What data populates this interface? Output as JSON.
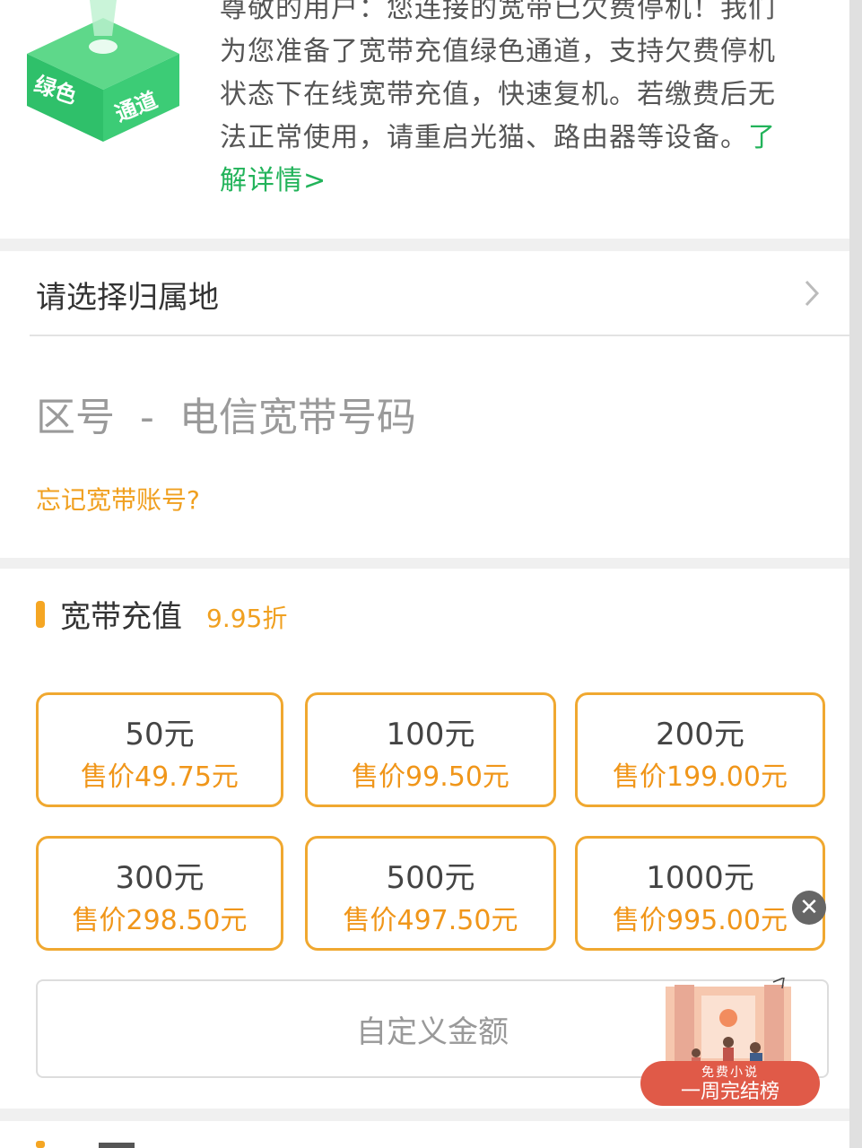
{
  "notice": {
    "badge_text_left": "绿色",
    "badge_text_right": "通道",
    "text": "尊敬的用户：您连接的宽带已欠费停机！我们为您准备了宽带充值绿色通道，支持欠费停机状态下在线宽带充值，快速复机。若缴费后无法正常使用，请重启光猫、路由器等设备。",
    "link": "了解详情>"
  },
  "region": {
    "label": "请选择归属地"
  },
  "phone": {
    "placeholder": "区号  -  电信宽带号码"
  },
  "forgot_link": "忘记宽带账号?",
  "recharge": {
    "title": "宽带充值",
    "discount": "9.95折",
    "options": [
      {
        "face": "50元",
        "price": "售价49.75元"
      },
      {
        "face": "100元",
        "price": "售价99.50元"
      },
      {
        "face": "200元",
        "price": "售价199.00元"
      },
      {
        "face": "300元",
        "price": "售价298.50元"
      },
      {
        "face": "500元",
        "price": "售价497.50元"
      },
      {
        "face": "1000元",
        "price": "售价995.00元"
      }
    ],
    "custom_label": "自定义金额"
  },
  "ad": {
    "line1": "免费小说",
    "line2": "一周完结榜",
    "close": "✕"
  },
  "colors": {
    "accent_orange": "#f0a830",
    "link_green": "#22b35a",
    "ad_red": "#e05a48"
  }
}
